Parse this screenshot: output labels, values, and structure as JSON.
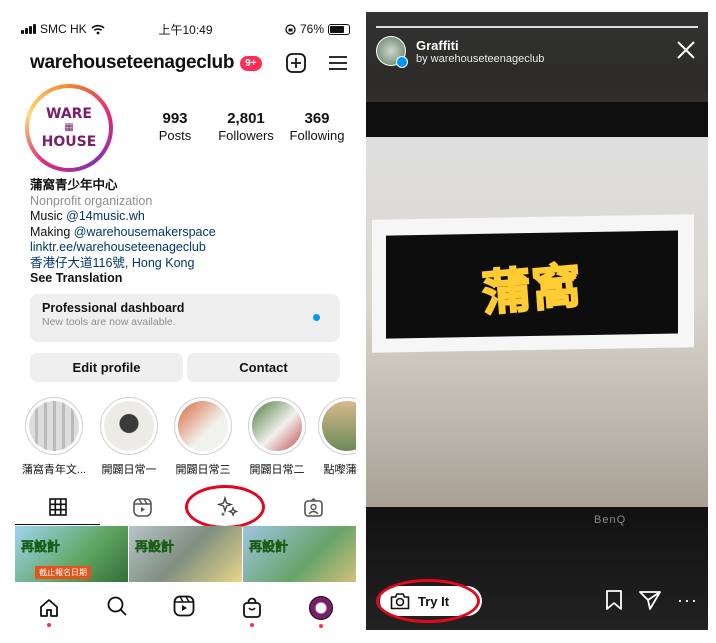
{
  "status_bar": {
    "carrier": "SMC HK",
    "time": "上午10:49",
    "battery": "76%"
  },
  "profile": {
    "username": "warehouseteenageclub",
    "notification_badge": "9+",
    "logo_lines": [
      "WARE",
      "HOUSE"
    ],
    "stats": [
      {
        "value": "993",
        "label": "Posts"
      },
      {
        "value": "2,801",
        "label": "Followers"
      },
      {
        "value": "369",
        "label": "Following"
      }
    ],
    "bio": {
      "name": "蒲窩青少年中心",
      "category": "Nonprofit organization",
      "line1_prefix": "Music ",
      "line1_mention": "@14music.wh",
      "line2_prefix": "Making ",
      "line2_mention": "@warehousemakerspace",
      "link": "linktr.ee/warehouseteenageclub",
      "address": "香港仔大道116號, Hong Kong",
      "translation": "See Translation"
    },
    "dashboard": {
      "title": "Professional dashboard",
      "subtitle": "New tools are now available."
    },
    "buttons": {
      "edit": "Edit profile",
      "contact": "Contact"
    },
    "highlights": [
      {
        "label": "蒲窩青年文..."
      },
      {
        "label": "開闢日常一"
      },
      {
        "label": "開闢日常三"
      },
      {
        "label": "開闢日常二"
      },
      {
        "label": "點嚟蒲"
      }
    ],
    "thumbs": [
      {
        "text": "再設計",
        "tag": "截止報名日期"
      },
      {
        "text": "再設計",
        "tag": ""
      },
      {
        "text": "再設計",
        "tag": ""
      }
    ]
  },
  "story": {
    "title": "Graffiti",
    "subtitle": "by warehouseteenageclub",
    "try_label": "Try It",
    "brand": "BenQ",
    "graffiti": "蒲窩"
  },
  "colors": {
    "accent": "#0095f6",
    "highlight_circle": "#e2071c",
    "badge": "#ff2d55"
  }
}
